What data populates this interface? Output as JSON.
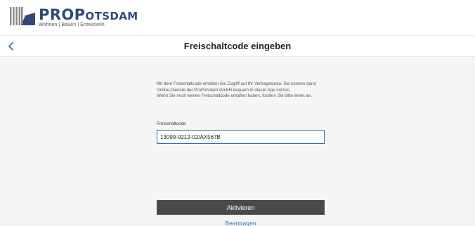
{
  "brand": {
    "name_pro": "PRO",
    "name_p": "P",
    "name_rest": "OTSDAM",
    "tagline": "Wohnen | Bauen | Entwickeln",
    "colors": {
      "primary": "#2f4a78",
      "mark_gray": "#8a8a8a"
    },
    "logo_icon": "propotsdam-logo-icon"
  },
  "header": {
    "back_icon": "chevron-left-icon",
    "title": "Freischaltcode eingeben"
  },
  "intro": {
    "paragraph1": "Mit dem Freischaltcode erhalten Sie Zugriff auf Ihr Vertragskonto. Sie können dann Online-Dienste der ProPotsdam GmbH bequem in dieser App nutzen.",
    "paragraph2": "Wenn Sie noch keinen Freischaltcode erhalten haben, fordern Sie bitte einen an."
  },
  "form": {
    "code_label": "Freischaltcode",
    "code_value": "13099-0212-02/AX567B"
  },
  "actions": {
    "activate_label": "Aktivieren",
    "apply_label": "Beantragen"
  },
  "colors": {
    "accent": "#2f6fb0",
    "button_bg": "#4a4a4a",
    "content_bg": "#f5f5f5"
  }
}
